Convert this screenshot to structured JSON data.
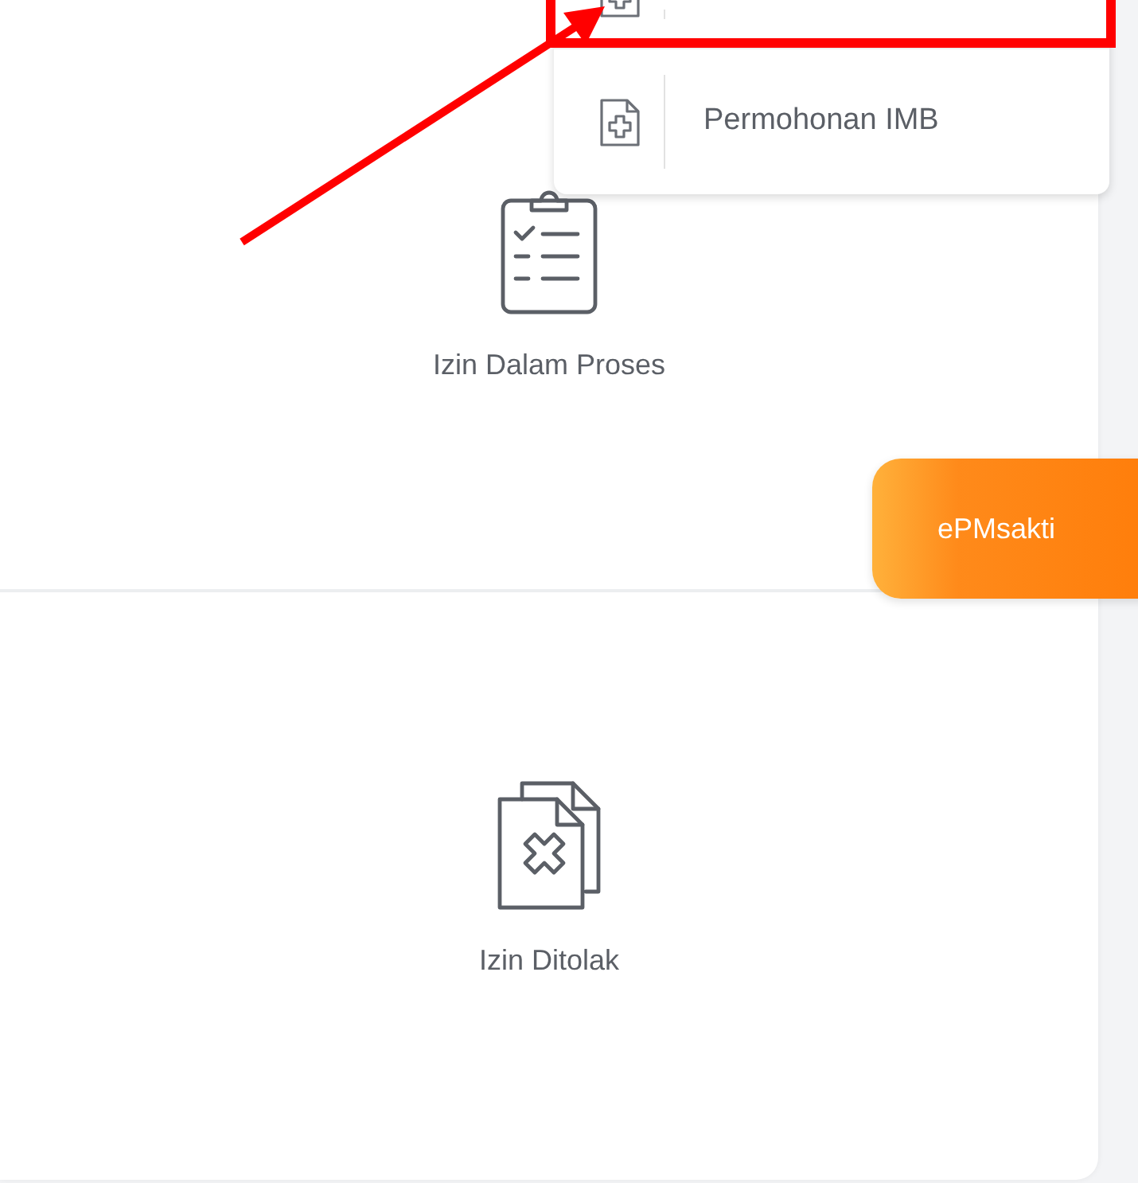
{
  "tiles": [
    {
      "kind": "clipboard",
      "label": "Izin Dalam Proses"
    },
    {
      "kind": "rejected",
      "label": "Izin Ditolak"
    }
  ],
  "dropdown": {
    "items": [
      {
        "kind": "partial",
        "highlighted": true
      },
      {
        "kind": "full",
        "label": "Permohonan IMB",
        "highlighted": false
      }
    ]
  },
  "floating_button": {
    "label": "ePMsakti"
  }
}
